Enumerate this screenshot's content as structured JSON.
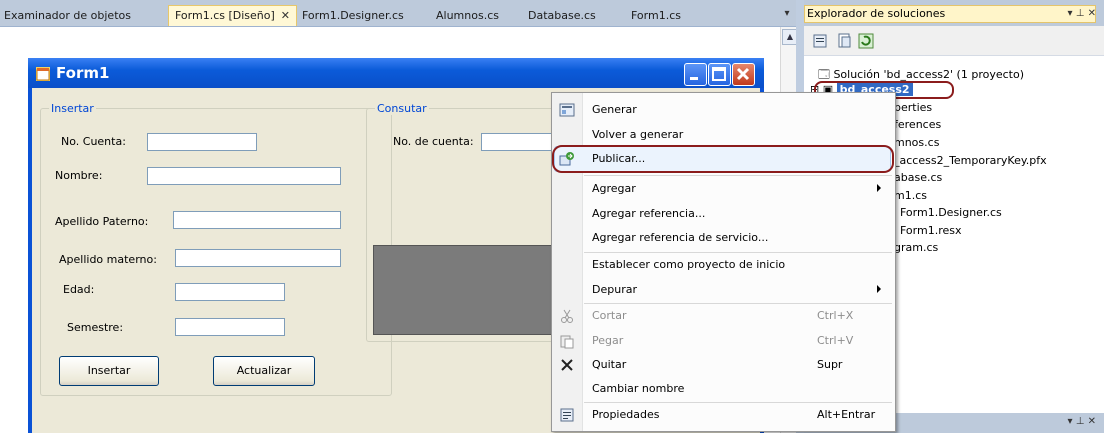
{
  "tabs": [
    {
      "label": "Examinador de objetos",
      "active": false
    },
    {
      "label": "Form1.cs [Diseño]",
      "active": true
    },
    {
      "label": "Form1.Designer.cs",
      "active": false
    },
    {
      "label": "Alumnos.cs",
      "active": false
    },
    {
      "label": "Database.cs",
      "active": false
    },
    {
      "label": "Form1.cs",
      "active": false
    }
  ],
  "tab_close_glyph": "✕",
  "overflow_glyph": "▾",
  "form": {
    "title": "Form1",
    "insert_group": {
      "title": "Insertar",
      "fields": [
        "No. Cuenta:",
        "Nombre:",
        "Apellido Paterno:",
        "Apellido materno:",
        "Edad:",
        "Semestre:"
      ],
      "insert_button": "Insertar",
      "update_button": "Actualizar"
    },
    "query_group": {
      "title": "Consutar",
      "account_label": "No. de cuenta:"
    }
  },
  "solution_explorer": {
    "title": "Explorador de soluciones",
    "title_controls": "▾ ⊥ ✕",
    "solution": "Solución 'bd_access2' (1 proyecto)",
    "project": "bd_access2",
    "items": [
      "perties",
      "ferences",
      "mnos.cs",
      "_access2_TemporaryKey.pfx",
      "abase.cs",
      "m1.cs",
      "Form1.Designer.cs",
      "Form1.resx",
      "gram.cs"
    ]
  },
  "properties_panel": {
    "controls": "▾ ⊥ ✕"
  },
  "context_menu": {
    "items": [
      {
        "label": "Generar",
        "icon": "build-icon"
      },
      {
        "label": "Volver a generar"
      },
      {
        "label": "Publicar...",
        "icon": "publish-icon",
        "highlighted": true
      },
      {
        "label": "Agregar",
        "submenu": true
      },
      {
        "label": "Agregar referencia..."
      },
      {
        "label": "Agregar referencia de servicio..."
      },
      {
        "label": "Establecer como proyecto de inicio"
      },
      {
        "label": "Depurar",
        "submenu": true
      },
      {
        "label": "Cortar",
        "shortcut": "Ctrl+X",
        "disabled": true,
        "icon": "cut-icon"
      },
      {
        "label": "Pegar",
        "shortcut": "Ctrl+V",
        "disabled": true,
        "icon": "paste-icon"
      },
      {
        "label": "Quitar",
        "shortcut": "Supr",
        "icon": "remove-icon"
      },
      {
        "label": "Cambiar nombre"
      },
      {
        "label": "Propiedades",
        "shortcut": "Alt+Entrar",
        "icon": "properties-icon"
      }
    ]
  },
  "colors": {
    "accent": "#316ac5",
    "highlight_ring": "#8b1c1c",
    "titlebar": "#0b5bd9"
  }
}
